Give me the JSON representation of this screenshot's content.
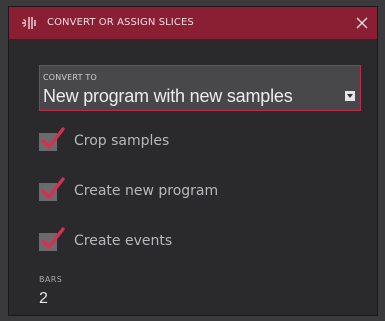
{
  "dialog": {
    "title": "CONVERT OR ASSIGN SLICES",
    "icon": "slices-icon",
    "accent_color": "#8a1f34"
  },
  "convert": {
    "label": "CONVERT TO",
    "value": "New program with new samples"
  },
  "options": [
    {
      "label": "Crop samples",
      "checked": true
    },
    {
      "label": "Create new program",
      "checked": true
    },
    {
      "label": "Create events",
      "checked": true
    }
  ],
  "bars": {
    "label": "BARS",
    "value": "2"
  }
}
